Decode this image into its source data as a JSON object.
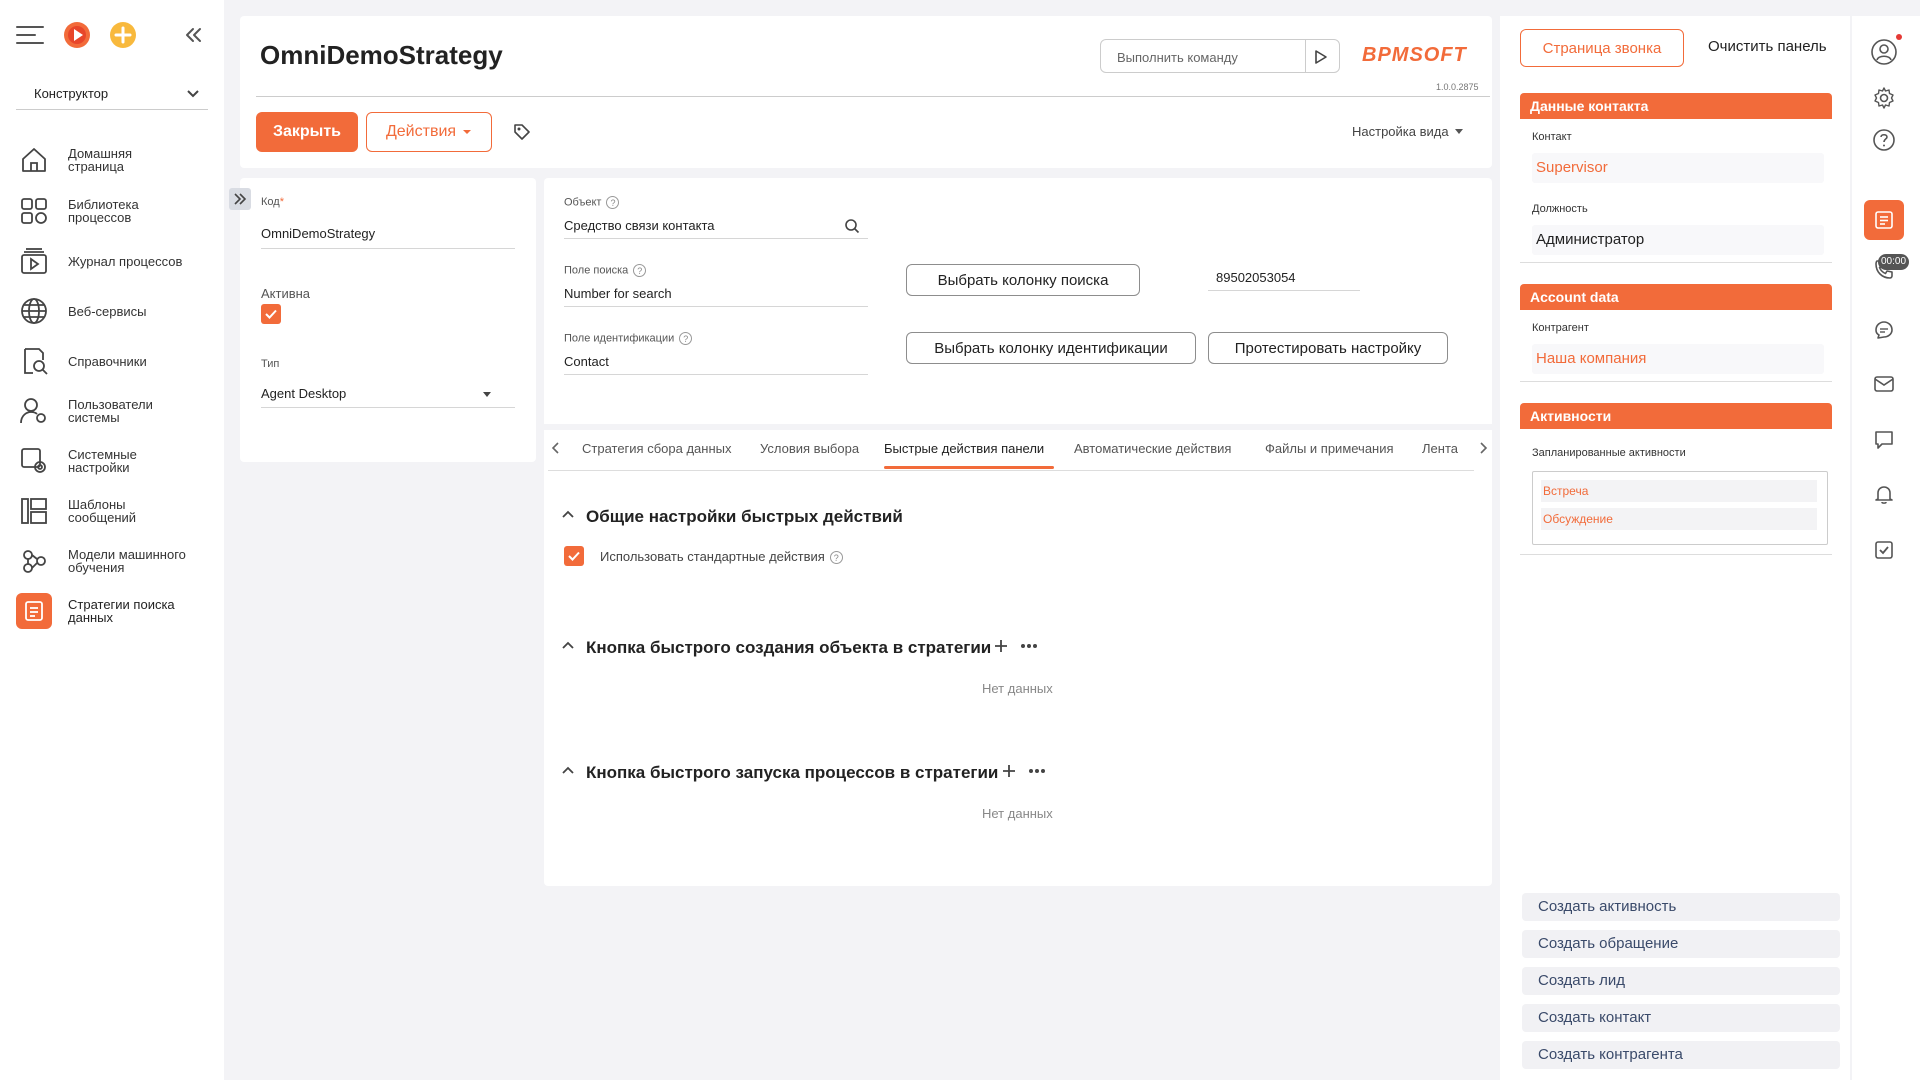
{
  "nav": {
    "dropdown": "Конструктор",
    "items": [
      {
        "label_line1": "Домашняя",
        "label_line2": "страница",
        "icon": "home-icon"
      },
      {
        "label_line1": "Библиотека",
        "label_line2": "процессов",
        "icon": "process-library-icon"
      },
      {
        "label_line1": "Журнал процессов",
        "label_line2": "",
        "icon": "process-log-icon"
      },
      {
        "label_line1": "Веб-сервисы",
        "label_line2": "",
        "icon": "globe-icon"
      },
      {
        "label_line1": "Справочники",
        "label_line2": "",
        "icon": "lookup-icon"
      },
      {
        "label_line1": "Пользователи",
        "label_line2": "системы",
        "icon": "users-icon"
      },
      {
        "label_line1": "Системные",
        "label_line2": "настройки",
        "icon": "system-settings-icon"
      },
      {
        "label_line1": "Шаблоны",
        "label_line2": "сообщений",
        "icon": "templates-icon"
      },
      {
        "label_line1": "Модели машинного",
        "label_line2": "обучения",
        "icon": "ml-models-icon"
      },
      {
        "label_line1": "Стратегии поиска",
        "label_line2": "данных",
        "icon": "search-strategies-icon"
      }
    ]
  },
  "header": {
    "title": "OmniDemoStrategy",
    "command_placeholder": "Выполнить команду",
    "logo": "BPMSOFT",
    "version": "1.0.0.2875",
    "close_label": "Закрыть",
    "actions_label": "Действия",
    "view_settings_label": "Настройка вида"
  },
  "left_form": {
    "code_label": "Код",
    "code_required": "*",
    "code_value": "OmniDemoStrategy",
    "active_label": "Активна",
    "type_label": "Тип",
    "type_value": "Agent Desktop"
  },
  "main_form": {
    "object_label": "Объект",
    "object_value": "Средство связи контакта",
    "search_field_label": "Поле поиска",
    "search_field_value": "Number for search",
    "id_field_label": "Поле идентификации",
    "id_field_value": "Contact",
    "choose_search_col": "Выбрать колонку поиска",
    "phone_value": "89502053054",
    "choose_id_col": "Выбрать колонку идентификации",
    "test_settings": "Протестировать настройку"
  },
  "tabs": [
    "Стратегия сбора данных",
    "Условия выбора",
    "Быстрые действия панели",
    "Автоматические действия",
    "Файлы и примечания",
    "Лента"
  ],
  "active_tab": "Быстрые действия панели",
  "sections": {
    "general_title": "Общие настройки быстрых действий",
    "use_standard_label": "Использовать стандартные действия",
    "create_object_title": "Кнопка быстрого создания объекта в стратегии",
    "create_object_empty": "Нет данных",
    "run_process_title": "Кнопка быстрого запуска процессов в стратегии",
    "run_process_empty": "Нет данных"
  },
  "right_panel": {
    "call_page_label": "Страница звонка",
    "clear_panel_label": "Очистить панель",
    "contact_data_title": "Данные контакта",
    "contact_label": "Контакт",
    "contact_value": "Supervisor",
    "position_label": "Должность",
    "position_value": "Администратор",
    "account_data_title": "Account data",
    "account_label": "Контрагент",
    "account_value": "Наша компания",
    "activities_title": "Активности",
    "planned_label": "Запланированные активности",
    "activity_items": [
      "Встреча",
      "Обсуждение"
    ],
    "quick_actions": [
      "Создать активность",
      "Создать обращение",
      "Создать лид",
      "Создать контакт",
      "Создать контрагента"
    ]
  },
  "right_bar": {
    "timer": "00:00"
  },
  "colors": {
    "accent": "#f26b3a",
    "nav_bg": "#ffffff",
    "page_bg": "#f3f3f6"
  }
}
